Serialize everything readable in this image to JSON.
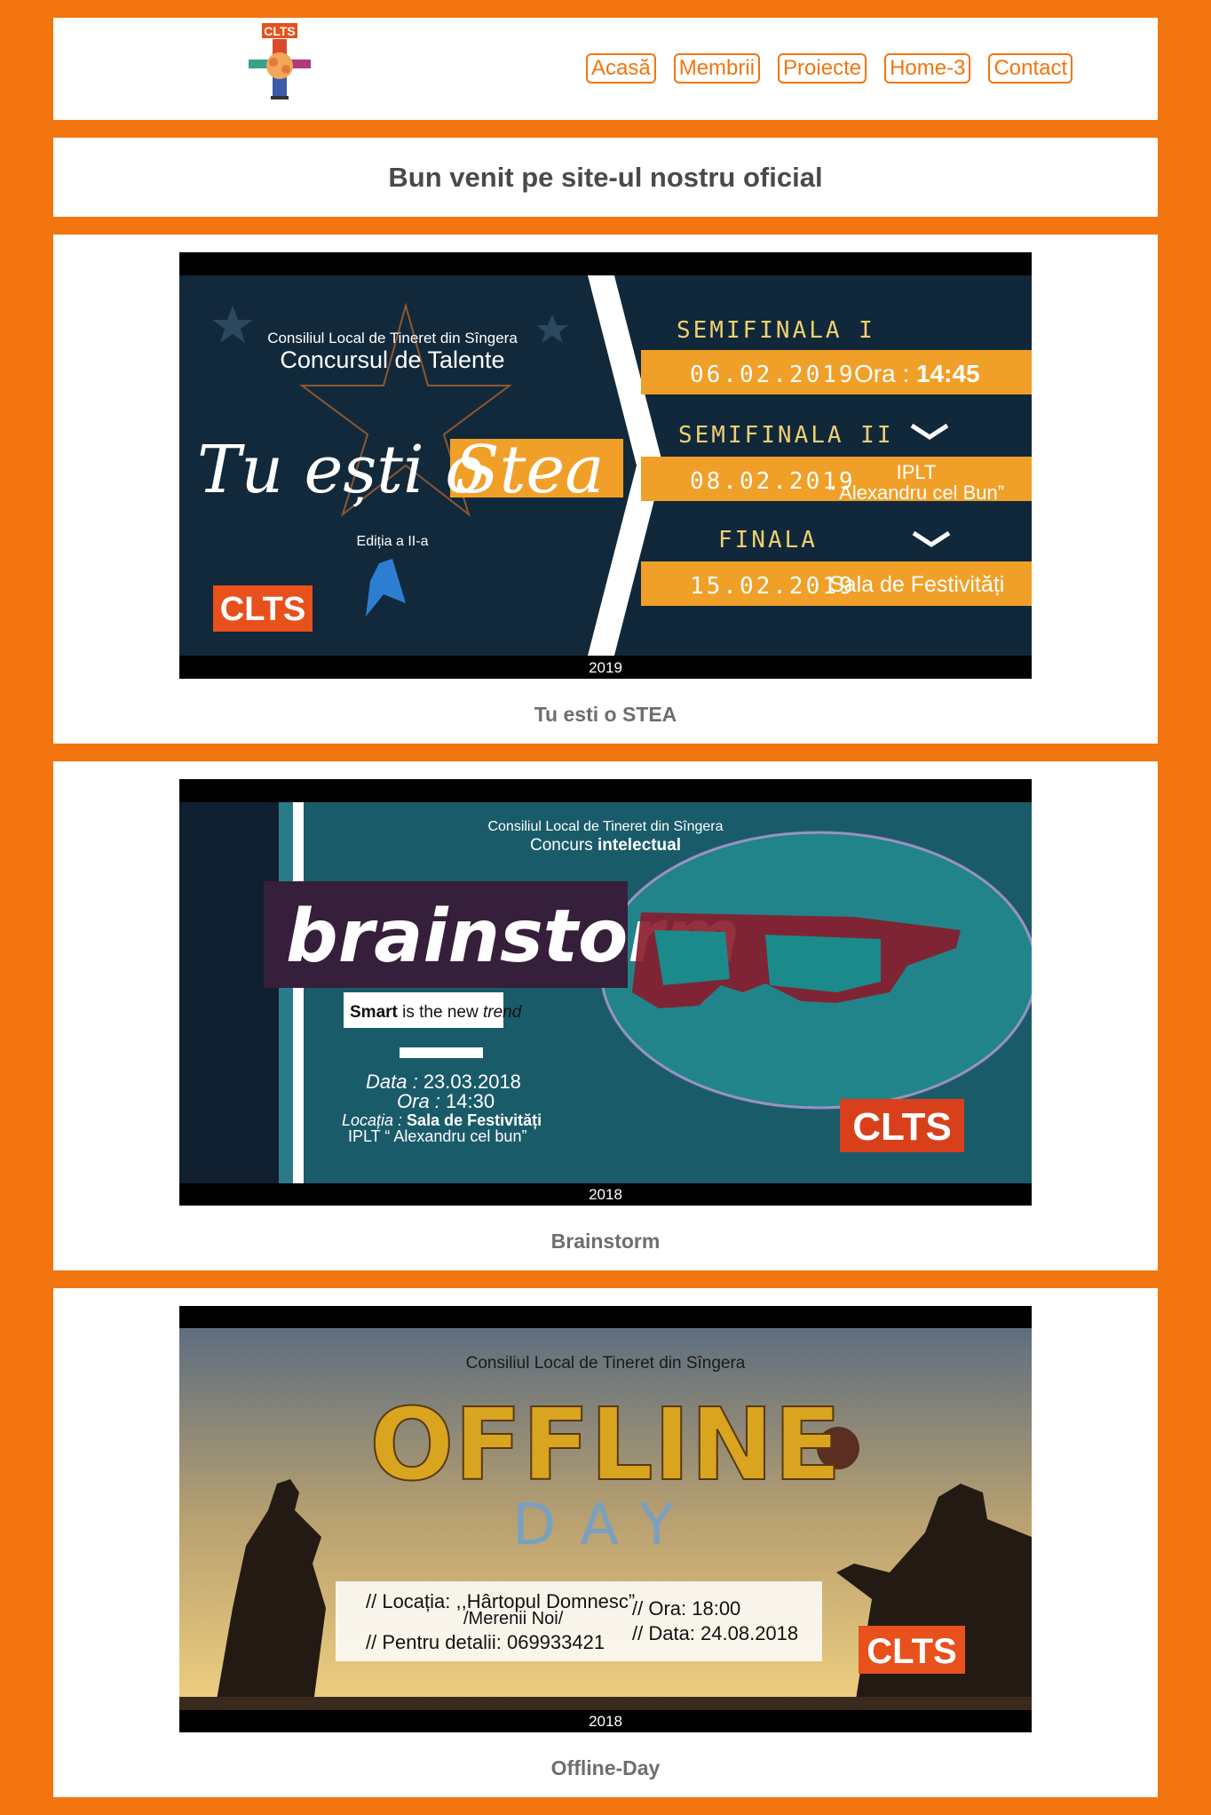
{
  "header": {
    "logo_text": "CLTS",
    "nav": [
      "Acasă",
      "Membrii",
      "Proiecte",
      "Home-3",
      "Contact"
    ]
  },
  "welcome": {
    "title": "Bun venit pe site-ul nostru oficial"
  },
  "projects": [
    {
      "caption": "Tu esti o STEA",
      "year": "2019",
      "poster": {
        "org": "Consiliul Local de Tineret din Sîngera",
        "subtitle": "Concursul de Talente",
        "title_script": "Tu ești o",
        "title_highlight": "Stea",
        "edition": "Ediția a II-a",
        "logo": "CLTS",
        "schedule": [
          {
            "stage": "SEMIFINALA I",
            "date": "06.02.2019",
            "info_label": "Ora : ",
            "info_value": "14:45"
          },
          {
            "stage": "SEMIFINALA II",
            "date": "08.02.2019",
            "info_line1": "IPLT",
            "info_line2": "“ Alexandru cel Bun”"
          },
          {
            "stage": "FINALA",
            "date": "15.02.2019",
            "info_value": "Sala de Festivități"
          }
        ]
      }
    },
    {
      "caption": "Brainstorm",
      "year": "2018",
      "poster": {
        "org": "Consiliul Local de Tineret din Sîngera",
        "subtitle_a": "Concurs ",
        "subtitle_b": "intelectual",
        "title": "brainstorm",
        "tagline_smart": "Smart",
        "tagline_rest": " is the new ",
        "tagline_trend": "trend",
        "date_label": "Data : ",
        "date_value": "23.03.2018",
        "time_label": "Ora : ",
        "time_value": "14:30",
        "loc_label": "Locația : ",
        "loc_value": "Sala de Festivități",
        "loc_line2": "IPLT “ Alexandru cel bun”",
        "logo": "CLTS"
      }
    },
    {
      "caption": "Offline-Day",
      "year": "2018",
      "poster": {
        "org": "Consiliul Local de Tineret din Sîngera",
        "title": "OFFLINE",
        "title2": "DAY",
        "loc_line1": "// Locația: ,,Hârtopul Domnesc”",
        "loc_line2": "/Merenii Noi/",
        "contact": "// Pentru detalii: 069933421",
        "time": "// Ora: 18:00",
        "date": "// Data: 24.08.2018",
        "logo": "CLTS"
      }
    }
  ],
  "colors": {
    "accent": "#f2750f",
    "poster_orange": "#f0a028",
    "poster_navy": "#12293b"
  }
}
